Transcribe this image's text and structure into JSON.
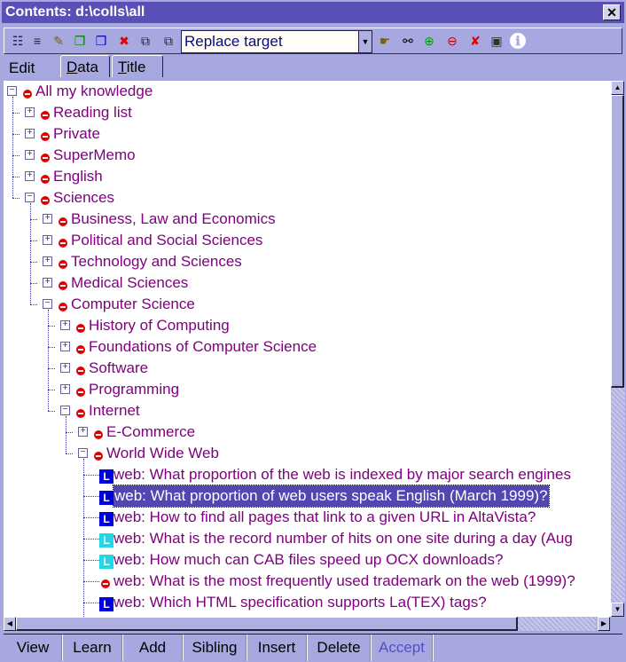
{
  "window": {
    "title": "Contents: d:\\colls\\all",
    "close_label": "✕"
  },
  "toolbar": {
    "left_icons": [
      {
        "name": "expand-all-icon",
        "glyph": "☷",
        "color": "#202040"
      },
      {
        "name": "collapse-icon",
        "glyph": "≡",
        "color": "#202040"
      },
      {
        "name": "edit-element-icon",
        "glyph": "✎",
        "color": "#806000"
      },
      {
        "name": "copy-icon",
        "glyph": "❐",
        "color": "#008000"
      },
      {
        "name": "paste-icon",
        "glyph": "❐",
        "color": "#0000c0"
      },
      {
        "name": "delete-icon",
        "glyph": "✖",
        "color": "#e00000"
      },
      {
        "name": "move-icon",
        "glyph": "⧉",
        "color": "#202040"
      },
      {
        "name": "replace-icon",
        "glyph": "⧉",
        "color": "#202040"
      }
    ],
    "combo_value": "Replace target",
    "right_icons": [
      {
        "name": "link-hand-icon",
        "glyph": "☛",
        "color": "#806000"
      },
      {
        "name": "binoculars-icon",
        "glyph": "⚯",
        "color": "#000000"
      },
      {
        "name": "add-branch-icon",
        "glyph": "⊕",
        "color": "#00a000"
      },
      {
        "name": "remove-branch-icon",
        "glyph": "⊖",
        "color": "#c00000"
      },
      {
        "name": "cut-icon",
        "glyph": "✘",
        "color": "#e00000"
      },
      {
        "name": "save-icon",
        "glyph": "▣",
        "color": "#303030"
      },
      {
        "name": "info-icon",
        "glyph": "ℹ",
        "color": "#ffffff"
      }
    ]
  },
  "tabs": [
    {
      "label": "Edit",
      "underline": "",
      "rest": "Edit",
      "active": true
    },
    {
      "label": "Data",
      "underline": "D",
      "rest": "ata",
      "active": false
    },
    {
      "label": "Title",
      "underline": "T",
      "rest": "itle",
      "active": false
    }
  ],
  "tree": {
    "rows": [
      {
        "level": 0,
        "expander": "minus",
        "icon": "stop",
        "label": "All my knowledge"
      },
      {
        "level": 1,
        "expander": "plus",
        "icon": "stop",
        "label": "Reading list"
      },
      {
        "level": 1,
        "expander": "plus",
        "icon": "stop",
        "label": "Private"
      },
      {
        "level": 1,
        "expander": "plus",
        "icon": "stop",
        "label": "SuperMemo"
      },
      {
        "level": 1,
        "expander": "plus",
        "icon": "stop",
        "label": "English"
      },
      {
        "level": 1,
        "expander": "minus",
        "icon": "stop",
        "label": "Sciences"
      },
      {
        "level": 2,
        "expander": "plus",
        "icon": "stop",
        "label": "Business, Law and Economics"
      },
      {
        "level": 2,
        "expander": "plus",
        "icon": "stop",
        "label": "Political and Social Sciences"
      },
      {
        "level": 2,
        "expander": "plus",
        "icon": "stop",
        "label": "Technology and Sciences"
      },
      {
        "level": 2,
        "expander": "plus",
        "icon": "stop",
        "label": "Medical Sciences"
      },
      {
        "level": 2,
        "expander": "minus",
        "icon": "stop",
        "label": "Computer Science"
      },
      {
        "level": 3,
        "expander": "plus",
        "icon": "stop",
        "label": "History of Computing"
      },
      {
        "level": 3,
        "expander": "plus",
        "icon": "stop",
        "label": "Foundations of Computer Science"
      },
      {
        "level": 3,
        "expander": "plus",
        "icon": "stop",
        "label": "Software"
      },
      {
        "level": 3,
        "expander": "plus",
        "icon": "stop",
        "label": "Programming"
      },
      {
        "level": 3,
        "expander": "minus",
        "icon": "stop",
        "label": "Internet"
      },
      {
        "level": 4,
        "expander": "plus",
        "icon": "stop",
        "label": "E-Commerce"
      },
      {
        "level": 4,
        "expander": "minus",
        "icon": "stop",
        "label": "World Wide Web"
      },
      {
        "level": 5,
        "expander": "none",
        "icon": "item-blue",
        "label": "web: What proportion of the web is indexed by major search engines"
      },
      {
        "level": 5,
        "expander": "none",
        "icon": "item-blue",
        "label": "web: What proportion of web users speak English (March 1999)?",
        "selected": true
      },
      {
        "level": 5,
        "expander": "none",
        "icon": "item-blue",
        "label": "web: How to find all pages that link to a given URL in AltaVista?"
      },
      {
        "level": 5,
        "expander": "none",
        "icon": "item-cyan",
        "label": "web: What is the record number of hits on one site during a day (Aug"
      },
      {
        "level": 5,
        "expander": "none",
        "icon": "item-cyan",
        "label": "web: How much can CAB files speed up OCX downloads?"
      },
      {
        "level": 5,
        "expander": "none",
        "icon": "stop",
        "label": "web: What is the most frequently used trademark on the web (1999)?"
      },
      {
        "level": 5,
        "expander": "none",
        "icon": "item-blue",
        "label": "web: Which HTML specification supports La(TEX) tags?"
      }
    ],
    "item_icon_letter": "L",
    "colors": {
      "text": "#800080",
      "selection": "#5048b0",
      "item_blue": "#0000e0",
      "item_cyan": "#20d8e8",
      "stop": "#e00000"
    }
  },
  "bottom_buttons": [
    {
      "label": "View",
      "disabled": false
    },
    {
      "label": "Learn",
      "disabled": false
    },
    {
      "label": "Add",
      "disabled": false
    },
    {
      "label": "Sibling",
      "disabled": false
    },
    {
      "label": "Insert",
      "disabled": false
    },
    {
      "label": "Delete",
      "disabled": false
    },
    {
      "label": "Accept",
      "disabled": true
    }
  ],
  "scroll_arrows": {
    "up": "▲",
    "down": "▼",
    "left": "◀",
    "right": "▶"
  }
}
